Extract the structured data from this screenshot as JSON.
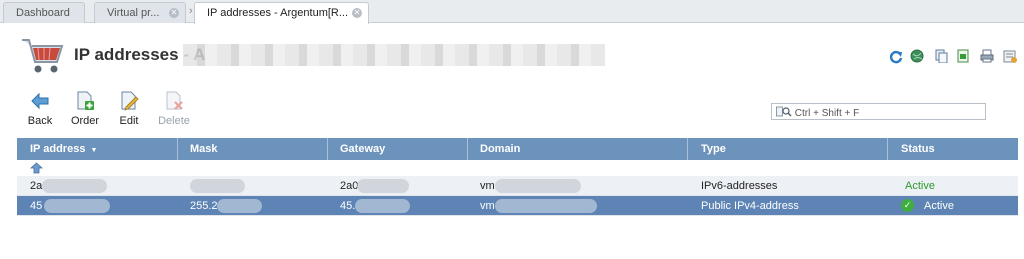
{
  "tabs": [
    {
      "label": "Dashboard",
      "closable": false,
      "active": false
    },
    {
      "label": "Virtual pr...",
      "closable": true,
      "active": false
    },
    {
      "label": "IP addresses - Argentum[R...",
      "closable": true,
      "active": true
    }
  ],
  "header": {
    "title": "IP addresses - A",
    "icons": [
      "refresh-icon",
      "globe-icon",
      "copy-icon",
      "export-icon",
      "print-icon",
      "settings-icon"
    ]
  },
  "toolbar": {
    "back_label": "Back",
    "order_label": "Order",
    "edit_label": "Edit",
    "delete_label": "Delete"
  },
  "search": {
    "placeholder": "Ctrl + Shift + F"
  },
  "table": {
    "columns": [
      "IP address",
      "Mask",
      "Gateway",
      "Domain",
      "Type",
      "Status"
    ],
    "sort_indicator": "▼",
    "rows": [
      {
        "ip": "2a",
        "mask": "",
        "gateway": "2a0",
        "domain": "vm",
        "type": "IPv6-addresses",
        "status": "Active",
        "selected": false
      },
      {
        "ip": "45",
        "mask": "255.2",
        "gateway": "45.",
        "domain": "vm",
        "type": "Public IPv4-address",
        "status": "Active",
        "selected": true
      }
    ]
  },
  "colors": {
    "header_bg": "#6c93bc",
    "selected_row": "#5d84b4",
    "active_status": "#2e9a2e"
  }
}
